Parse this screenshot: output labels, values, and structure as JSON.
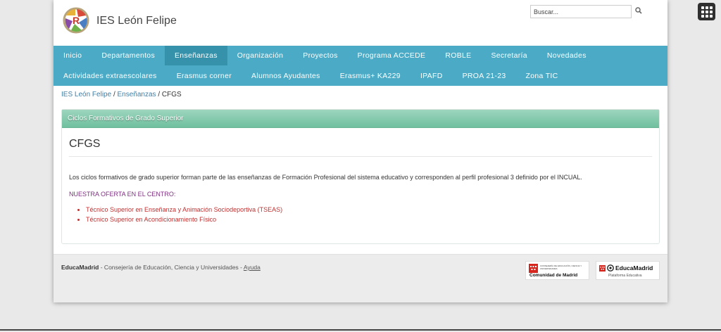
{
  "site": {
    "title": "IES León Felipe"
  },
  "search": {
    "placeholder": "Buscar..."
  },
  "nav": {
    "row1": [
      "Inicio",
      "Departamentos",
      "Enseñanzas",
      "Organización",
      "Proyectos",
      "Programa ACCEDE",
      "ROBLE",
      "Secretaría",
      "Novedades"
    ],
    "row2": [
      "Actividades extraescolares",
      "Erasmus corner",
      "Alumnos Ayudantes",
      "Erasmus+ KA229",
      "IPAFD",
      "PROA 21-23",
      "Zona TIC"
    ],
    "active": "Enseñanzas"
  },
  "breadcrumb": {
    "home": "IES León Felipe",
    "section": "Enseñanzas",
    "current": "CFGS",
    "sep": "/"
  },
  "panel": {
    "header": "Ciclos Formativos de Grado Superior",
    "heading": "CFGS",
    "intro": "Los ciclos formativos de grado superior forman parte de las enseñanzas de Formación Profesional del sistema educativo y corresponden al perfil profesional 3 definido por el INCUAL.",
    "offer_title": "NUESTRA OFERTA EN EL CENTRO:",
    "offers": [
      "Técnico Superior en Enseñanza y Animación Sociodeportiva (TSEAS)",
      "Técnico Superior en Acondicionamiento Físico"
    ]
  },
  "footer": {
    "brand": "EducaMadrid",
    "text": " - Consejería de Educación, Ciencia y Universidades - ",
    "help": "Ayuda",
    "badge_cm_small": "CONSEJERÍA DE EDUCACIÓN, CIENCIA Y UNIVERSIDADES",
    "badge_cm": "Comunidad de Madrid",
    "badge_em": "EducaMadrid",
    "badge_em_sub": "Plataforma Educativa"
  },
  "colors": {
    "nav": "#4babc6",
    "nav_active": "#3692ab",
    "panel_head": "#6fc09e",
    "accent_red": "#c03030",
    "offer_purple": "#7e2f80"
  }
}
